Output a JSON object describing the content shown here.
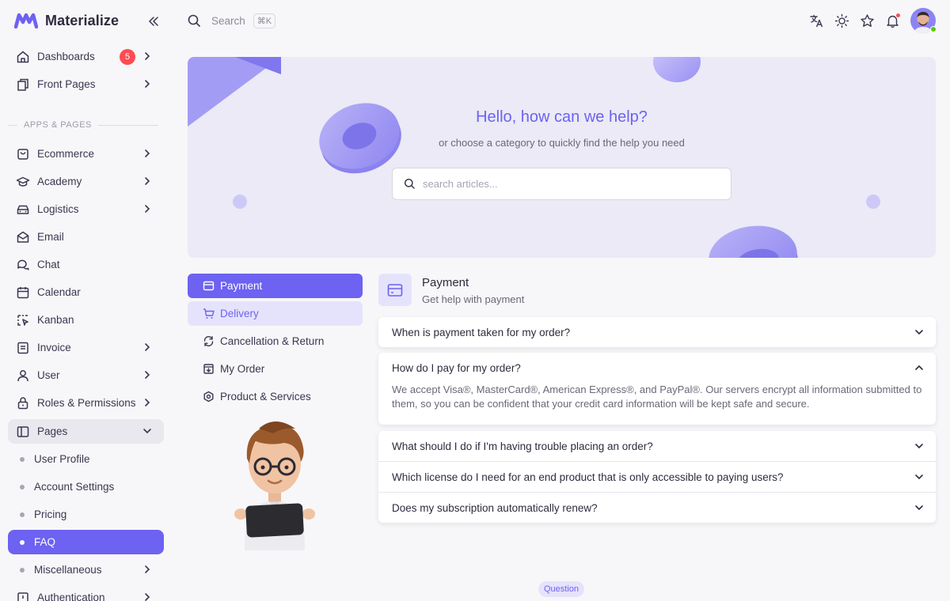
{
  "app": {
    "brand": "Materialize"
  },
  "sidebar": {
    "top_items": [
      {
        "label": "Dashboards",
        "badge": "5"
      },
      {
        "label": "Front Pages"
      }
    ],
    "section_label": "APPS & PAGES",
    "items": [
      {
        "label": "Ecommerce"
      },
      {
        "label": "Academy"
      },
      {
        "label": "Logistics"
      },
      {
        "label": "Email"
      },
      {
        "label": "Chat"
      },
      {
        "label": "Calendar"
      },
      {
        "label": "Kanban"
      },
      {
        "label": "Invoice"
      },
      {
        "label": "User"
      },
      {
        "label": "Roles & Permissions"
      },
      {
        "label": "Pages"
      }
    ],
    "pages_sub": [
      {
        "label": "User Profile"
      },
      {
        "label": "Account Settings"
      },
      {
        "label": "Pricing"
      },
      {
        "label": "FAQ"
      },
      {
        "label": "Miscellaneous"
      }
    ],
    "last_item": {
      "label": "Authentication"
    }
  },
  "topbar": {
    "search_label": "Search",
    "shortcut": "⌘K"
  },
  "hero": {
    "title": "Hello, how can we help?",
    "subtitle": "or choose a category to quickly find the help you need",
    "search_placeholder": "search articles..."
  },
  "categories": [
    {
      "label": "Payment"
    },
    {
      "label": "Delivery"
    },
    {
      "label": "Cancellation & Return"
    },
    {
      "label": "My Order"
    },
    {
      "label": "Product & Services"
    }
  ],
  "section": {
    "title": "Payment",
    "subtitle": "Get help with payment"
  },
  "faq": [
    {
      "question": "When is payment taken for my order?"
    },
    {
      "question": "How do I pay for my order?",
      "answer": "We accept Visa®, MasterCard®, American Express®, and PayPal®. Our servers encrypt all information submitted to them, so you can be confident that your credit card information will be kept safe and secure."
    },
    {
      "question": "What should I do if I'm having trouble placing an order?"
    },
    {
      "question": "Which license do I need for an end product that is only accessible to paying users?"
    },
    {
      "question": "Does my subscription automatically renew?"
    }
  ],
  "footer_chip": "Question",
  "colors": {
    "primary": "#6d62f1",
    "danger": "#ff4c51",
    "hero_bg": "#ebeaf6"
  }
}
